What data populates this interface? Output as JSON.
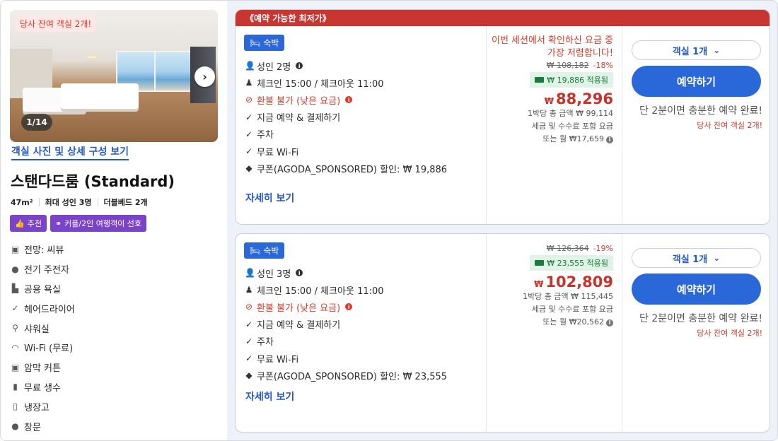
{
  "room": {
    "remaining_badge": "당사 잔여 객실 2개!",
    "photo_counter": "1/14",
    "gallery_link": "객실 사진 및 상세 구성 보기",
    "title": "스탠다드룸 (Standard)",
    "specs": [
      "47m²",
      "최대 성인 3명",
      "더블베드 2개"
    ],
    "tags": [
      {
        "label": "추천",
        "icon": "thumbs-up-icon"
      },
      {
        "label": "커플/2인 여행객이 선호",
        "icon": "couple-icon"
      }
    ],
    "amenities": [
      {
        "label": "전망: 씨뷰",
        "icon": "view-icon"
      },
      {
        "label": "전기 주전자",
        "icon": "kettle-icon"
      },
      {
        "label": "공용 욕실",
        "icon": "bathtub-icon"
      },
      {
        "label": "헤어드라이어",
        "icon": "check-icon"
      },
      {
        "label": "샤워실",
        "icon": "shower-icon"
      },
      {
        "label": "Wi-Fi (무료)",
        "icon": "wifi-icon"
      },
      {
        "label": "암막 커튼",
        "icon": "curtain-icon"
      },
      {
        "label": "무료 생수",
        "icon": "water-bottle-icon"
      },
      {
        "label": "냉장고",
        "icon": "fridge-icon"
      },
      {
        "label": "창문",
        "icon": "window-icon"
      }
    ]
  },
  "offers": [
    {
      "ribbon": "《예약 가능한 최저가》",
      "stay_badge": "숙박",
      "features": [
        {
          "text": "성인 2명",
          "icon": "person-icon",
          "info": true,
          "red": false
        },
        {
          "text": "체크인 15:00 / 체크아웃 11:00",
          "icon": "checkin-icon",
          "info": false,
          "red": false
        },
        {
          "text": "환불 불가 (낮은 요금)",
          "icon": "no-refund-icon",
          "info": true,
          "red": true
        },
        {
          "text": "지금 예약 & 결제하기",
          "icon": "check-icon",
          "info": false,
          "red": false
        },
        {
          "text": "주차",
          "icon": "check-icon",
          "info": false,
          "red": false
        },
        {
          "text": "무료 Wi-Fi",
          "icon": "check-icon",
          "info": false,
          "red": false
        },
        {
          "text": "쿠폰(AGODA_SPONSORED) 할인: ₩ 19,886",
          "icon": "coupon-icon",
          "info": false,
          "red": false
        }
      ],
      "details_link": "자세히 보기",
      "session_note": "이번 세션에서 확인하신 요금 중 가장 저렴합니다!",
      "original_price": "₩ 108,182",
      "discount_pct": "-18%",
      "coupon_applied": "₩ 19,886 적용됨",
      "currency": "₩",
      "price": "88,296",
      "total_per_night": "1박당 총 금액 ₩ 99,114",
      "tax_note": "세금 및 수수료 포함 요금",
      "monthly": "또는 월 ₩17,659",
      "qty_label": "객실 1개",
      "book_label": "예약하기",
      "urgency": "단 2분이면 충분한 예약 완료!",
      "urgency_sub": "당사 잔여 객실 2개!"
    },
    {
      "ribbon": "",
      "stay_badge": "숙박",
      "features": [
        {
          "text": "성인 3명",
          "icon": "person-icon",
          "info": true,
          "red": false
        },
        {
          "text": "체크인 15:00 / 체크아웃 11:00",
          "icon": "checkin-icon",
          "info": false,
          "red": false
        },
        {
          "text": "환불 불가 (낮은 요금)",
          "icon": "no-refund-icon",
          "info": true,
          "red": true
        },
        {
          "text": "지금 예약 & 결제하기",
          "icon": "check-icon",
          "info": false,
          "red": false
        },
        {
          "text": "주차",
          "icon": "check-icon",
          "info": false,
          "red": false
        },
        {
          "text": "무료 Wi-Fi",
          "icon": "check-icon",
          "info": false,
          "red": false
        },
        {
          "text": "쿠폰(AGODA_SPONSORED) 할인: ₩ 23,555",
          "icon": "coupon-icon",
          "info": false,
          "red": false
        }
      ],
      "details_link": "자세히 보기",
      "session_note": "",
      "original_price": "₩ 126,364",
      "discount_pct": "-19%",
      "coupon_applied": "₩ 23,555 적용됨",
      "currency": "₩",
      "price": "102,809",
      "total_per_night": "1박당 총 금액 ₩ 115,445",
      "tax_note": "세금 및 수수료 포함 요금",
      "monthly": "또는 월 ₩20,562",
      "qty_label": "객실 1개",
      "book_label": "예약하기",
      "urgency": "단 2분이면 충분한 예약 완료!",
      "urgency_sub": "당사 잔여 객실 2개!"
    }
  ],
  "colors": {
    "accent_blue": "#2a67d8",
    "link_blue": "#2458c6",
    "deal_red": "#c93530",
    "tag_purple": "#7b44c8",
    "coupon_green": "#1b7a3c"
  }
}
